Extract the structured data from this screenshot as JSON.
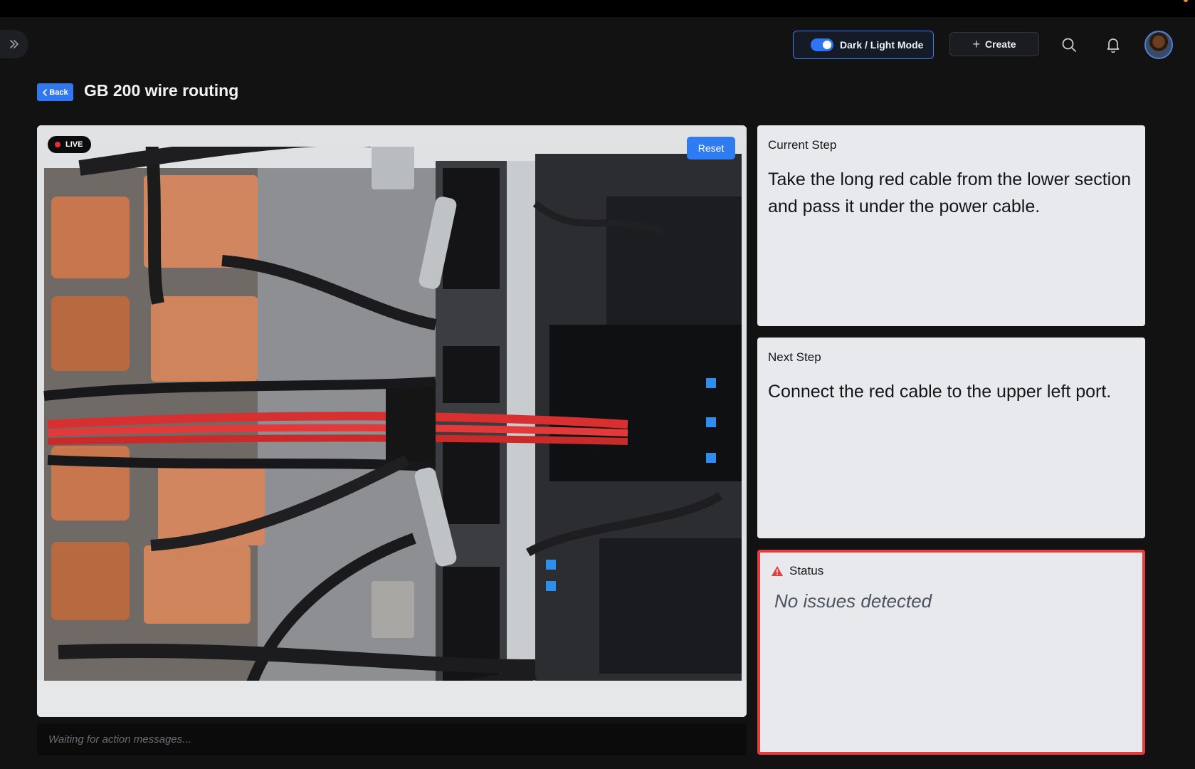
{
  "header": {
    "mode_toggle_label": "Dark / Light Mode",
    "mode_toggle_on": true,
    "create_label": "Create",
    "accent_color": "#2f7cf0"
  },
  "page": {
    "back_label": "Back",
    "title": "GB 200 wire routing"
  },
  "video": {
    "live_label": "LIVE",
    "reset_label": "Reset"
  },
  "messages": {
    "placeholder": "Waiting for action messages..."
  },
  "current_step": {
    "heading": "Current Step",
    "text": "Take the long red cable from the lower section and pass it under the power cable."
  },
  "next_step": {
    "heading": "Next Step",
    "text": "Connect the red cable to the upper left port."
  },
  "status": {
    "heading": "Status",
    "text": "No issues detected",
    "alert_color": "#e43d3d"
  },
  "icons": [
    "chevrons-right-icon",
    "plus-icon",
    "search-icon",
    "bell-icon",
    "avatar",
    "chevron-left-icon",
    "warning-icon"
  ]
}
